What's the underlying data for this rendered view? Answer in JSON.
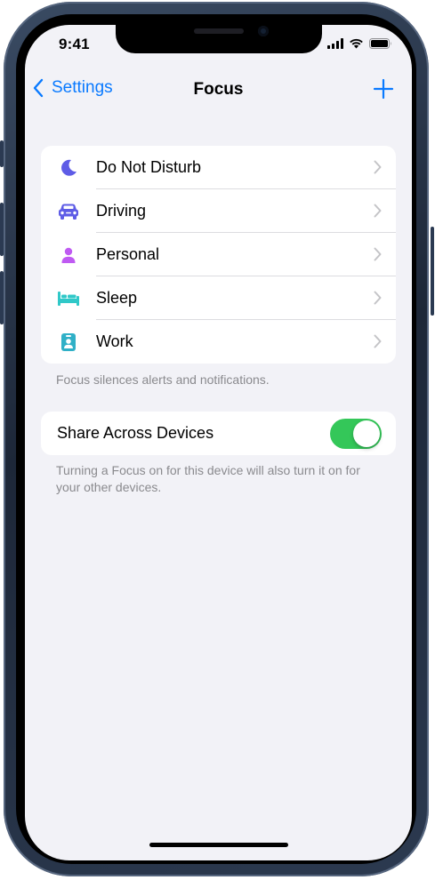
{
  "status_bar": {
    "time": "9:41"
  },
  "nav": {
    "back_label": "Settings",
    "title": "Focus"
  },
  "focus_modes": [
    {
      "label": "Do Not Disturb",
      "icon": "moon-icon",
      "color": "#5e5ce6"
    },
    {
      "label": "Driving",
      "icon": "car-icon",
      "color": "#5e5ce6"
    },
    {
      "label": "Personal",
      "icon": "person-icon",
      "color": "#bf5af2"
    },
    {
      "label": "Sleep",
      "icon": "bed-icon",
      "color": "#30c8c8"
    },
    {
      "label": "Work",
      "icon": "id-badge-icon",
      "color": "#30b0c7"
    }
  ],
  "modes_footer": "Focus silences alerts and notifications.",
  "share": {
    "label": "Share Across Devices",
    "enabled": true,
    "footer": "Turning a Focus on for this device will also turn it on for your other devices."
  },
  "colors": {
    "accent": "#0a7aff",
    "toggle_on": "#34c759",
    "background": "#f2f2f7"
  }
}
